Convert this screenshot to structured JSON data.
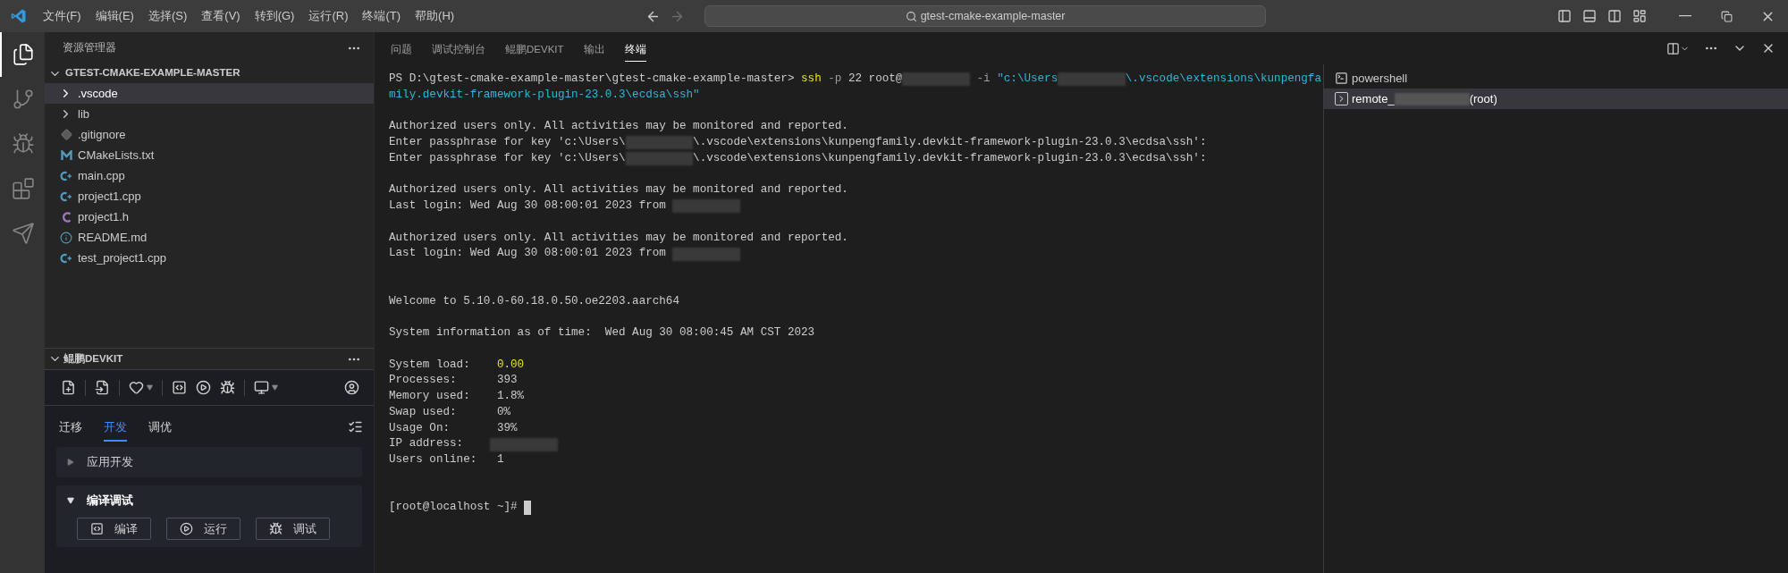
{
  "title_bar": {
    "menu": [
      "文件(F)",
      "编辑(E)",
      "选择(S)",
      "查看(V)",
      "转到(G)",
      "运行(R)",
      "终端(T)",
      "帮助(H)"
    ],
    "back_disabled": false,
    "forward_disabled": true,
    "search": "gtest-cmake-example-master"
  },
  "activity_bar": [
    {
      "kind": "explorer",
      "selected": true
    },
    {
      "kind": "source-control",
      "selected": false
    },
    {
      "kind": "run-debug",
      "selected": false
    },
    {
      "kind": "extensions",
      "selected": false
    },
    {
      "kind": "send",
      "selected": false
    }
  ],
  "explorer": {
    "title": "资源管理器",
    "root": {
      "label": "GTEST-CMAKE-EXAMPLE-MASTER",
      "expanded": true,
      "children": [
        {
          "label": ".vscode",
          "kind": "folder",
          "expanded": false,
          "selected": true
        },
        {
          "label": "lib",
          "kind": "folder",
          "expanded": false,
          "selected": false
        },
        {
          "label": ".gitignore",
          "kind": "git",
          "selected": false
        },
        {
          "label": "CMakeLists.txt",
          "kind": "cmake",
          "selected": false
        },
        {
          "label": "main.cpp",
          "kind": "cpp",
          "selected": false
        },
        {
          "label": "project1.cpp",
          "kind": "cpp",
          "selected": false
        },
        {
          "label": "project1.h",
          "kind": "header",
          "selected": false
        },
        {
          "label": "README.md",
          "kind": "info",
          "selected": false
        },
        {
          "label": "test_project1.cpp",
          "kind": "cpp",
          "selected": false
        }
      ]
    }
  },
  "devkit": {
    "title": "鲲鹏DEVKIT",
    "expanded": true,
    "tabs": [
      {
        "label": "迁移",
        "selected": false
      },
      {
        "label": "开发",
        "selected": true
      },
      {
        "label": "调优",
        "selected": false
      }
    ],
    "sections": [
      {
        "title": "应用开发",
        "expanded": false
      },
      {
        "title": "编译调试",
        "expanded": true,
        "buttons": [
          {
            "kind": "compile",
            "label": "编译"
          },
          {
            "kind": "run",
            "label": "运行"
          },
          {
            "kind": "debug",
            "label": "调试"
          }
        ]
      }
    ]
  },
  "panel": {
    "tabs": [
      {
        "label": "问题",
        "selected": false
      },
      {
        "label": "调试控制台",
        "selected": false
      },
      {
        "label": "鲲鹏DEVKIT",
        "selected": false
      },
      {
        "label": "输出",
        "selected": false
      },
      {
        "label": "终端",
        "selected": true
      }
    ],
    "terminal": [
      {
        "segments": [
          {
            "kind": "plain",
            "text": "PS D:\\gtest-cmake-example-master\\gtest-cmake-example-master> "
          },
          {
            "kind": "command",
            "text": "ssh"
          },
          {
            "kind": "option",
            "text": " -p"
          },
          {
            "kind": "plain",
            "text": " 22 root@"
          },
          {
            "kind": "redacted"
          },
          {
            "kind": "option",
            "text": " -i "
          },
          {
            "kind": "string",
            "text": "\"c:\\Users"
          },
          {
            "kind": "redacted"
          },
          {
            "kind": "string",
            "text": "\\.vscode\\extensions\\kunpengfa"
          }
        ]
      },
      {
        "segments": [
          {
            "kind": "string",
            "text": "mily.devkit-framework-plugin-23.0.3\\ecdsa\\ssh\""
          }
        ]
      },
      {
        "blank_before": true,
        "segments": [
          {
            "kind": "plain",
            "text": "Authorized users only. All activities may be monitored and reported."
          }
        ]
      },
      {
        "segments": [
          {
            "kind": "plain",
            "text": "Enter passphrase for key 'c:\\Users\\"
          },
          {
            "kind": "redacted"
          },
          {
            "kind": "plain",
            "text": "\\.vscode\\extensions\\kunpengfamily.devkit-framework-plugin-23.0.3\\ecdsa\\ssh':"
          }
        ]
      },
      {
        "segments": [
          {
            "kind": "plain",
            "text": "Enter passphrase for key 'c:\\Users\\"
          },
          {
            "kind": "redacted"
          },
          {
            "kind": "plain",
            "text": "\\.vscode\\extensions\\kunpengfamily.devkit-framework-plugin-23.0.3\\ecdsa\\ssh':"
          }
        ]
      },
      {
        "blank_before": true,
        "segments": [
          {
            "kind": "plain",
            "text": "Authorized users only. All activities may be monitored and reported."
          }
        ]
      },
      {
        "segments": [
          {
            "kind": "plain",
            "text": "Last login: Wed Aug 30 08:00:01 2023 from "
          },
          {
            "kind": "redacted"
          }
        ]
      },
      {
        "blank_before": true,
        "segments": [
          {
            "kind": "plain",
            "text": "Authorized users only. All activities may be monitored and reported."
          }
        ]
      },
      {
        "segments": [
          {
            "kind": "plain",
            "text": "Last login: Wed Aug 30 08:00:01 2023 from "
          },
          {
            "kind": "redacted"
          }
        ]
      },
      {
        "blank_before": true,
        "extra_blank": true,
        "segments": [
          {
            "kind": "plain",
            "text": "Welcome to 5.10.0-60.18.0.50.oe2203.aarch64"
          }
        ]
      },
      {
        "blank_before": true,
        "segments": [
          {
            "kind": "plain",
            "text": "System information as of time:  Wed Aug 30 08:00:45 AM CST 2023"
          }
        ]
      },
      {
        "blank_before": true,
        "segments": [
          {
            "kind": "plain",
            "text": "System load:    "
          },
          {
            "kind": "value",
            "text": "0.00"
          }
        ]
      },
      {
        "segments": [
          {
            "kind": "plain",
            "text": "Processes:      393"
          }
        ]
      },
      {
        "segments": [
          {
            "kind": "plain",
            "text": "Memory used:    1.8%"
          }
        ]
      },
      {
        "segments": [
          {
            "kind": "plain",
            "text": "Swap used:      0%"
          }
        ]
      },
      {
        "segments": [
          {
            "kind": "plain",
            "text": "Usage On:       39%"
          }
        ]
      },
      {
        "segments": [
          {
            "kind": "plain",
            "text": "IP address:    "
          },
          {
            "kind": "redacted"
          }
        ]
      },
      {
        "segments": [
          {
            "kind": "plain",
            "text": "Users online:   1"
          }
        ]
      },
      {
        "blank_before": true,
        "extra_blank": true,
        "cursor": true,
        "segments": [
          {
            "kind": "plain",
            "text": "[root@localhost ~]# "
          }
        ]
      }
    ],
    "terminals": [
      {
        "kind": "powershell",
        "name_start": "powershell",
        "redacted": false,
        "selected": false
      },
      {
        "kind": "remote",
        "name_start": "remote_",
        "redacted": true,
        "name_end": "(root)",
        "selected": true
      }
    ]
  }
}
